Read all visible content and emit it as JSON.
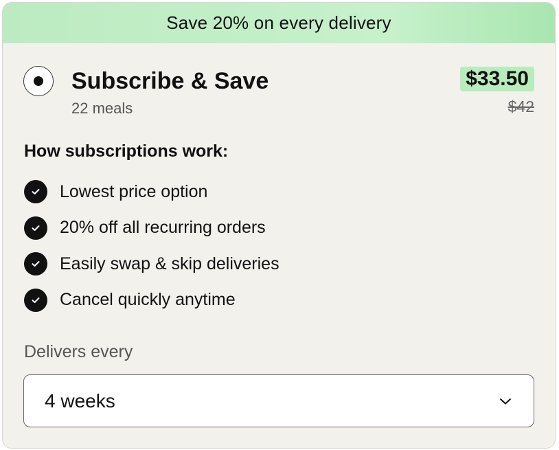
{
  "banner": {
    "text": "Save 20% on every delivery"
  },
  "plan": {
    "selected": true,
    "title": "Subscribe & Save",
    "meals": "22 meals",
    "price": "$33.50",
    "original_price": "$42"
  },
  "how": {
    "title": "How subscriptions work:",
    "features": [
      "Lowest price option",
      "20% off all recurring orders",
      "Easily swap & skip deliveries",
      "Cancel quickly anytime"
    ],
    "icon": "checkmark-circle-icon"
  },
  "delivery": {
    "label": "Delivers every",
    "selected": "4 weeks",
    "icon": "chevron-down-icon"
  },
  "colors": {
    "banner_green": "#bdebc1",
    "price_highlight": "#b8ecbd",
    "panel_bg": "#f3f1ec"
  }
}
